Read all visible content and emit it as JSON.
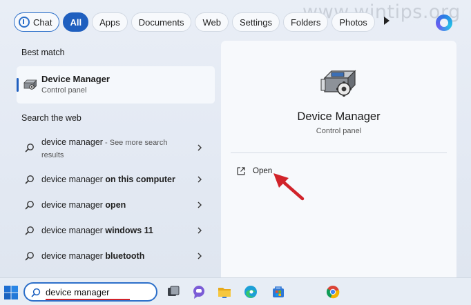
{
  "filters": {
    "chat": "Chat",
    "tabs": [
      "All",
      "Apps",
      "Documents",
      "Web",
      "Settings",
      "Folders",
      "Photos"
    ],
    "active": "All"
  },
  "watermark": "www.wintips.org",
  "best_match": {
    "heading": "Best match",
    "title": "Device Manager",
    "subtitle": "Control panel"
  },
  "search_web": {
    "heading": "Search the web",
    "items": [
      {
        "normal": "device manager",
        "bold": "",
        "hint": " - See more search",
        "hint2": "results"
      },
      {
        "normal": "device manager ",
        "bold": "on this computer",
        "hint": "",
        "hint2": ""
      },
      {
        "normal": "device manager ",
        "bold": "open",
        "hint": "",
        "hint2": ""
      },
      {
        "normal": "device manager ",
        "bold": "windows 11",
        "hint": "",
        "hint2": ""
      },
      {
        "normal": "device manager ",
        "bold": "bluetooth",
        "hint": "",
        "hint2": ""
      }
    ]
  },
  "detail": {
    "title": "Device Manager",
    "subtitle": "Control panel",
    "open_label": "Open"
  },
  "taskbar": {
    "search_value": "device manager"
  },
  "colors": {
    "accent": "#1f5fbf",
    "annotation_red": "#d1232a"
  },
  "icons": [
    "windows-start-icon",
    "search-icon",
    "task-view-icon",
    "teams-chat-icon",
    "file-explorer-icon",
    "edge-icon",
    "store-icon",
    "chrome-icon",
    "external-link-icon",
    "chevron-right-icon",
    "device-manager-icon",
    "bing-icon"
  ]
}
